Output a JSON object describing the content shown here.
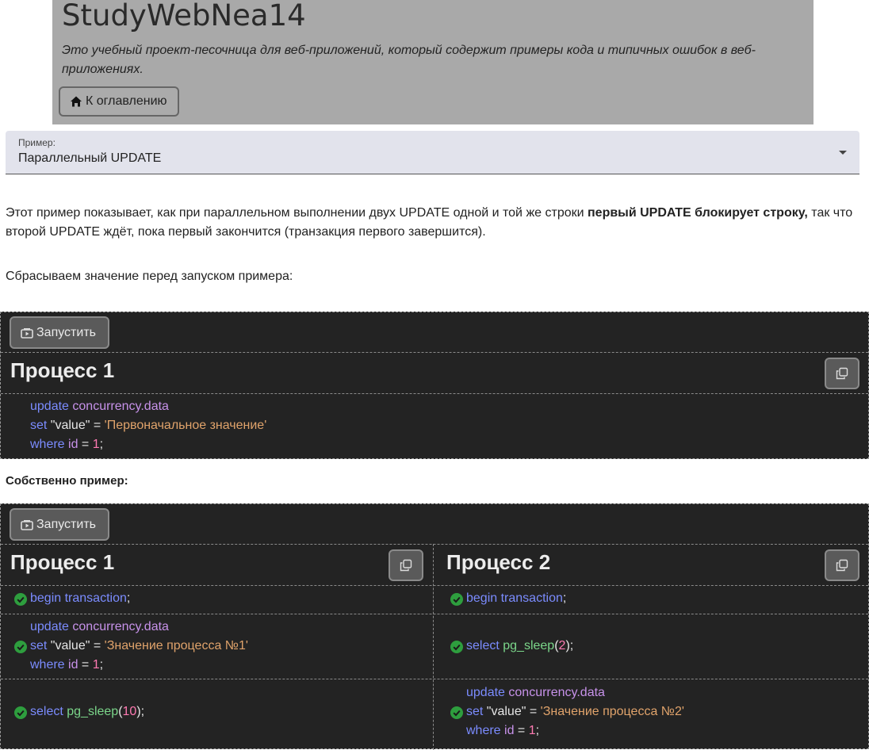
{
  "header": {
    "title": "StudyWebNea14",
    "description": "Это учебный проект-песочница для веб-приложений, который содержит примеры кода и типичных ошибок в веб-приложениях.",
    "toc_button": "К оглавлению"
  },
  "select": {
    "label": "Пример:",
    "value": "Параллельный UPDATE"
  },
  "intro": {
    "text_before": "Этот пример показывает, как при параллельном выполнении двух UPDATE одной и той же строки ",
    "bold": "первый UPDATE блокирует строку,",
    "text_after": " так что второй UPDATE ждёт, пока первый закончится (транзакция первого завершится)."
  },
  "reset_label": "Сбрасываем значение перед запуском примера:",
  "example_label": "Собственно пример:",
  "run_button": "Запустить",
  "block1": {
    "process_title": "Процесс 1",
    "code": {
      "l1_kw": "update",
      "l1_id": "concurrency.data",
      "l2_kw": "set",
      "l2_col": "\"value\"",
      "l2_eq": " = ",
      "l2_str": "'Первоначальное значение'",
      "l3_kw": "where",
      "l3_id": "id",
      "l3_eq": " = ",
      "l3_num": "1",
      "l3_end": ";"
    }
  },
  "block2": {
    "p1_title": "Процесс 1",
    "p2_title": "Процесс 2",
    "p1_s1": {
      "kw": "begin transaction",
      "end": ";"
    },
    "p2_s1": {
      "kw": "begin transaction",
      "end": ";"
    },
    "p1_s2": {
      "l1_kw": "update",
      "l1_id": "concurrency.data",
      "l2_kw": "set",
      "l2_col": "\"value\"",
      "l2_eq": " = ",
      "l2_str": "'Значение процесса №1'",
      "l3_kw": "where",
      "l3_id": "id",
      "l3_eq": " = ",
      "l3_num": "1",
      "l3_end": ";"
    },
    "p2_s2": {
      "kw": "select",
      "fn": "pg_sleep",
      "open": "(",
      "num": "2",
      "close": ");"
    },
    "p1_s3": {
      "kw": "select",
      "fn": "pg_sleep",
      "open": "(",
      "num": "10",
      "close": ");"
    },
    "p2_s3": {
      "l1_kw": "update",
      "l1_id": "concurrency.data",
      "l2_kw": "set",
      "l2_col": "\"value\"",
      "l2_eq": " = ",
      "l2_str": "'Значение процесса №2'",
      "l3_kw": "where",
      "l3_id": "id",
      "l3_eq": " = ",
      "l3_num": "1",
      "l3_end": ";"
    }
  },
  "icons": {
    "home": "home-icon",
    "run": "run-icon",
    "copy": "copy-icon",
    "check": "check-circle-icon",
    "dropdown": "chevron-down-icon"
  },
  "colors": {
    "keyword": "#7b8cff",
    "identifier": "#c792ea",
    "string": "#e0a36b",
    "number": "#ff7ab2",
    "function": "#7bd68a",
    "success": "#2e9e3e"
  }
}
